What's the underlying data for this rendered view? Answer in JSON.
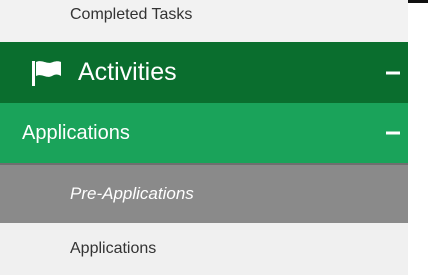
{
  "menu": {
    "completed_tasks": "Completed Tasks",
    "activities": {
      "label": "Activities",
      "icon": "flag-icon",
      "toggle": "collapse"
    },
    "applications_group": {
      "label": "Applications",
      "toggle": "collapse"
    },
    "items": [
      {
        "label": "Pre-Applications",
        "state": "selected"
      },
      {
        "label": "Applications"
      }
    ]
  },
  "colors": {
    "activities_bg": "#0a6e2e",
    "applications_bg": "#1aa35a",
    "selected_bg": "#8a8a8a",
    "item_bg": "#f0f0f0"
  }
}
